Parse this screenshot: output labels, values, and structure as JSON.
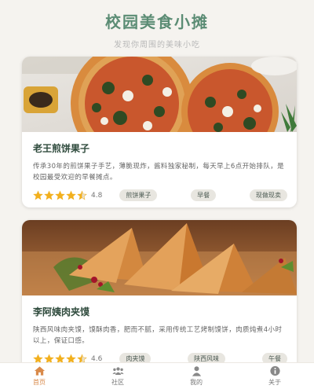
{
  "header": {
    "title": "校园美食小摊",
    "subtitle": "发现你周围的美味小吃"
  },
  "cards": [
    {
      "photo_icon": "pizza-photo",
      "title": "老王煎饼果子",
      "description": "传承30年的煎饼果子手艺，薄脆现炸，酱料独家秘制，每天早上6点开始排队，是校园最受欢迎的早餐摊点。",
      "stars": 4.5,
      "rating": "4.8",
      "tags": [
        "煎饼果子",
        "早餐",
        "现做现卖"
      ]
    },
    {
      "photo_icon": "samosa-photo",
      "title": "李阿姨肉夹馍",
      "description": "陕西风味肉夹馍，馍酥肉香，肥而不腻，采用传统工艺烤制馍饼，肉质炖煮4小时以上，保证口感。",
      "stars": 4.5,
      "rating": "4.6",
      "tags": [
        "肉夹馍",
        "陕西风味",
        "午餐"
      ]
    }
  ],
  "tabbar": {
    "tabs": [
      {
        "label": "首页",
        "icon": "home-icon",
        "active": true
      },
      {
        "label": "社区",
        "icon": "community-icon",
        "active": false
      },
      {
        "label": "我的",
        "icon": "user-icon",
        "active": false
      },
      {
        "label": "关于",
        "icon": "info-icon",
        "active": false
      }
    ]
  },
  "colors": {
    "title_green": "#5b8c74",
    "star_gold": "#f2b01e",
    "active_orange": "#d98a4a"
  }
}
